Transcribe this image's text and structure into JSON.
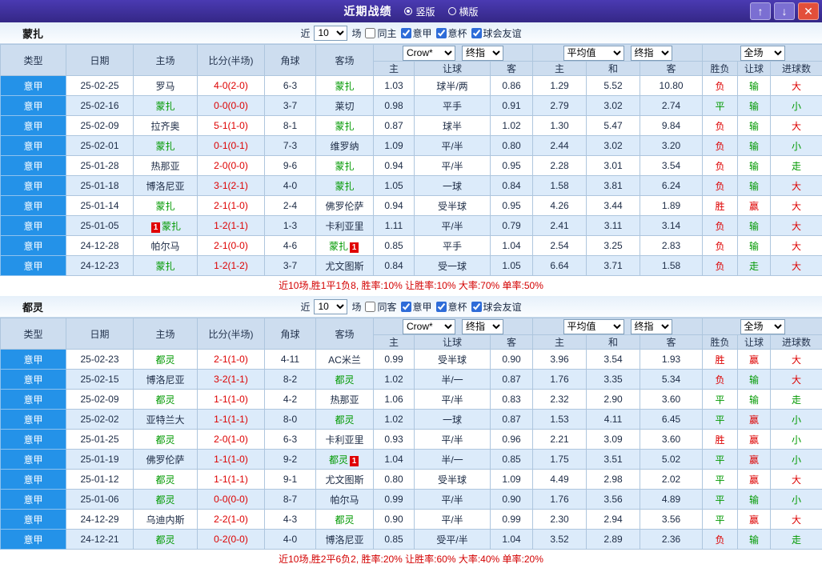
{
  "colors": {
    "red": "#dd0000",
    "green": "#009900",
    "score": "#dd0000",
    "team_green": "#009900",
    "type_col_bg": "#2492e8",
    "badge_bg": "#e00000",
    "titlebar_bg": "#3f31a4",
    "close_btn_bg": "#e34f3a",
    "nav_btn_bg": "#7b6fd2"
  },
  "value_colors": {
    "胜": "red",
    "负": "red",
    "平": "green",
    "赢": "red",
    "输": "green",
    "走": "green",
    "大": "red",
    "小": "green"
  },
  "titlebar": {
    "title": "近期战绩",
    "vertical_label": "竖版",
    "horizontal_label": "横版",
    "up_icon": "↑",
    "down_icon": "↓",
    "close_icon": "✕"
  },
  "filter": {
    "near": "近",
    "count": "10",
    "games": "场",
    "league": "意甲",
    "cup": "意杯",
    "friendly": "球会友谊",
    "same_checked": false,
    "league_checked": true,
    "cup_checked": true,
    "friendly_checked": true
  },
  "header": {
    "type": "类型",
    "date": "日期",
    "home": "主场",
    "score": "比分(半场)",
    "corner": "角球",
    "away": "客场",
    "crow": "Crow*",
    "final1": "终指",
    "avg": "平均值",
    "final2": "终指",
    "full": "全场",
    "h": "主",
    "handicap": "让球",
    "a": "客",
    "avg_h": "主",
    "avg_d": "和",
    "avg_a": "客",
    "result": "胜负",
    "hc_result": "让球",
    "goals": "进球数"
  },
  "sections": [
    {
      "team": "蒙扎",
      "same_filter": "同主",
      "summary": "近10场,胜1平1负8, 胜率:10% 让胜率:10% 大率:70% 单率:50%",
      "rows": [
        {
          "league": "意甲",
          "date": "25-02-25",
          "home": {
            "name": "罗马"
          },
          "score": "4-0(2-0)",
          "corner": "6-3",
          "away": {
            "name": "蒙扎",
            "self": true
          },
          "o1": "1.03",
          "hc": "球半/两",
          "o2": "0.86",
          "a1": "1.29",
          "a2": "5.52",
          "a3": "10.80",
          "res": "负",
          "hcr": "输",
          "goal": "大"
        },
        {
          "league": "意甲",
          "date": "25-02-16",
          "home": {
            "name": "蒙扎",
            "self": true
          },
          "score": "0-0(0-0)",
          "corner": "3-7",
          "away": {
            "name": "莱切"
          },
          "o1": "0.98",
          "hc": "平手",
          "o2": "0.91",
          "a1": "2.79",
          "a2": "3.02",
          "a3": "2.74",
          "res": "平",
          "hcr": "输",
          "goal": "小"
        },
        {
          "league": "意甲",
          "date": "25-02-09",
          "home": {
            "name": "拉齐奥"
          },
          "score": "5-1(1-0)",
          "corner": "8-1",
          "away": {
            "name": "蒙扎",
            "self": true
          },
          "o1": "0.87",
          "hc": "球半",
          "o2": "1.02",
          "a1": "1.30",
          "a2": "5.47",
          "a3": "9.84",
          "res": "负",
          "hcr": "输",
          "goal": "大"
        },
        {
          "league": "意甲",
          "date": "25-02-01",
          "home": {
            "name": "蒙扎",
            "self": true
          },
          "score": "0-1(0-1)",
          "corner": "7-3",
          "away": {
            "name": "维罗纳"
          },
          "o1": "1.09",
          "hc": "平/半",
          "o2": "0.80",
          "a1": "2.44",
          "a2": "3.02",
          "a3": "3.20",
          "res": "负",
          "hcr": "输",
          "goal": "小"
        },
        {
          "league": "意甲",
          "date": "25-01-28",
          "home": {
            "name": "热那亚"
          },
          "score": "2-0(0-0)",
          "corner": "9-6",
          "away": {
            "name": "蒙扎",
            "self": true
          },
          "o1": "0.94",
          "hc": "平/半",
          "o2": "0.95",
          "a1": "2.28",
          "a2": "3.01",
          "a3": "3.54",
          "res": "负",
          "hcr": "输",
          "goal": "走"
        },
        {
          "league": "意甲",
          "date": "25-01-18",
          "home": {
            "name": "博洛尼亚"
          },
          "score": "3-1(2-1)",
          "corner": "4-0",
          "away": {
            "name": "蒙扎",
            "self": true
          },
          "o1": "1.05",
          "hc": "一球",
          "o2": "0.84",
          "a1": "1.58",
          "a2": "3.81",
          "a3": "6.24",
          "res": "负",
          "hcr": "输",
          "goal": "大"
        },
        {
          "league": "意甲",
          "date": "25-01-14",
          "home": {
            "name": "蒙扎",
            "self": true
          },
          "score": "2-1(1-0)",
          "corner": "2-4",
          "away": {
            "name": "佛罗伦萨"
          },
          "o1": "0.94",
          "hc": "受半球",
          "o2": "0.95",
          "a1": "4.26",
          "a2": "3.44",
          "a3": "1.89",
          "res": "胜",
          "hcr": "赢",
          "goal": "大"
        },
        {
          "league": "意甲",
          "date": "25-01-05",
          "home": {
            "name": "蒙扎",
            "self": true,
            "badge": "1",
            "badge_pos": "before"
          },
          "score": "1-2(1-1)",
          "corner": "1-3",
          "away": {
            "name": "卡利亚里"
          },
          "o1": "1.11",
          "hc": "平/半",
          "o2": "0.79",
          "a1": "2.41",
          "a2": "3.11",
          "a3": "3.14",
          "res": "负",
          "hcr": "输",
          "goal": "大"
        },
        {
          "league": "意甲",
          "date": "24-12-28",
          "home": {
            "name": "帕尔马"
          },
          "score": "2-1(0-0)",
          "corner": "4-6",
          "away": {
            "name": "蒙扎",
            "self": true,
            "badge": "1",
            "badge_pos": "after"
          },
          "o1": "0.85",
          "hc": "平手",
          "o2": "1.04",
          "a1": "2.54",
          "a2": "3.25",
          "a3": "2.83",
          "res": "负",
          "hcr": "输",
          "goal": "大"
        },
        {
          "league": "意甲",
          "date": "24-12-23",
          "home": {
            "name": "蒙扎",
            "self": true
          },
          "score": "1-2(1-2)",
          "corner": "3-7",
          "away": {
            "name": "尤文图斯"
          },
          "o1": "0.84",
          "hc": "受一球",
          "o2": "1.05",
          "a1": "6.64",
          "a2": "3.71",
          "a3": "1.58",
          "res": "负",
          "hcr": "走",
          "goal": "大"
        }
      ]
    },
    {
      "team": "都灵",
      "same_filter": "同客",
      "summary": "近10场,胜2平6负2, 胜率:20% 让胜率:60% 大率:40% 单率:20%",
      "rows": [
        {
          "league": "意甲",
          "date": "25-02-23",
          "home": {
            "name": "都灵",
            "self": true
          },
          "score": "2-1(1-0)",
          "corner": "4-11",
          "away": {
            "name": "AC米兰"
          },
          "o1": "0.99",
          "hc": "受半球",
          "o2": "0.90",
          "a1": "3.96",
          "a2": "3.54",
          "a3": "1.93",
          "res": "胜",
          "hcr": "赢",
          "goal": "大"
        },
        {
          "league": "意甲",
          "date": "25-02-15",
          "home": {
            "name": "博洛尼亚"
          },
          "score": "3-2(1-1)",
          "corner": "8-2",
          "away": {
            "name": "都灵",
            "self": true
          },
          "o1": "1.02",
          "hc": "半/一",
          "o2": "0.87",
          "a1": "1.76",
          "a2": "3.35",
          "a3": "5.34",
          "res": "负",
          "hcr": "输",
          "goal": "大"
        },
        {
          "league": "意甲",
          "date": "25-02-09",
          "home": {
            "name": "都灵",
            "self": true
          },
          "score": "1-1(1-0)",
          "corner": "4-2",
          "away": {
            "name": "热那亚"
          },
          "o1": "1.06",
          "hc": "平/半",
          "o2": "0.83",
          "a1": "2.32",
          "a2": "2.90",
          "a3": "3.60",
          "res": "平",
          "hcr": "输",
          "goal": "走"
        },
        {
          "league": "意甲",
          "date": "25-02-02",
          "home": {
            "name": "亚特兰大"
          },
          "score": "1-1(1-1)",
          "corner": "8-0",
          "away": {
            "name": "都灵",
            "self": true
          },
          "o1": "1.02",
          "hc": "一球",
          "o2": "0.87",
          "a1": "1.53",
          "a2": "4.11",
          "a3": "6.45",
          "res": "平",
          "hcr": "赢",
          "goal": "小"
        },
        {
          "league": "意甲",
          "date": "25-01-25",
          "home": {
            "name": "都灵",
            "self": true
          },
          "score": "2-0(1-0)",
          "corner": "6-3",
          "away": {
            "name": "卡利亚里"
          },
          "o1": "0.93",
          "hc": "平/半",
          "o2": "0.96",
          "a1": "2.21",
          "a2": "3.09",
          "a3": "3.60",
          "res": "胜",
          "hcr": "赢",
          "goal": "小"
        },
        {
          "league": "意甲",
          "date": "25-01-19",
          "home": {
            "name": "佛罗伦萨"
          },
          "score": "1-1(1-0)",
          "corner": "9-2",
          "away": {
            "name": "都灵",
            "self": true,
            "badge": "1",
            "badge_pos": "after"
          },
          "o1": "1.04",
          "hc": "半/一",
          "o2": "0.85",
          "a1": "1.75",
          "a2": "3.51",
          "a3": "5.02",
          "res": "平",
          "hcr": "赢",
          "goal": "小"
        },
        {
          "league": "意甲",
          "date": "25-01-12",
          "home": {
            "name": "都灵",
            "self": true
          },
          "score": "1-1(1-1)",
          "corner": "9-1",
          "away": {
            "name": "尤文图斯"
          },
          "o1": "0.80",
          "hc": "受半球",
          "o2": "1.09",
          "a1": "4.49",
          "a2": "2.98",
          "a3": "2.02",
          "res": "平",
          "hcr": "赢",
          "goal": "大"
        },
        {
          "league": "意甲",
          "date": "25-01-06",
          "home": {
            "name": "都灵",
            "self": true
          },
          "score": "0-0(0-0)",
          "corner": "8-7",
          "away": {
            "name": "帕尔马"
          },
          "o1": "0.99",
          "hc": "平/半",
          "o2": "0.90",
          "a1": "1.76",
          "a2": "3.56",
          "a3": "4.89",
          "res": "平",
          "hcr": "输",
          "goal": "小"
        },
        {
          "league": "意甲",
          "date": "24-12-29",
          "home": {
            "name": "乌迪内斯"
          },
          "score": "2-2(1-0)",
          "corner": "4-3",
          "away": {
            "name": "都灵",
            "self": true
          },
          "o1": "0.90",
          "hc": "平/半",
          "o2": "0.99",
          "a1": "2.30",
          "a2": "2.94",
          "a3": "3.56",
          "res": "平",
          "hcr": "赢",
          "goal": "大"
        },
        {
          "league": "意甲",
          "date": "24-12-21",
          "home": {
            "name": "都灵",
            "self": true
          },
          "score": "0-2(0-0)",
          "corner": "4-0",
          "away": {
            "name": "博洛尼亚"
          },
          "o1": "0.85",
          "hc": "受平/半",
          "o2": "1.04",
          "a1": "3.52",
          "a2": "2.89",
          "a3": "2.36",
          "res": "负",
          "hcr": "输",
          "goal": "走"
        }
      ]
    }
  ]
}
